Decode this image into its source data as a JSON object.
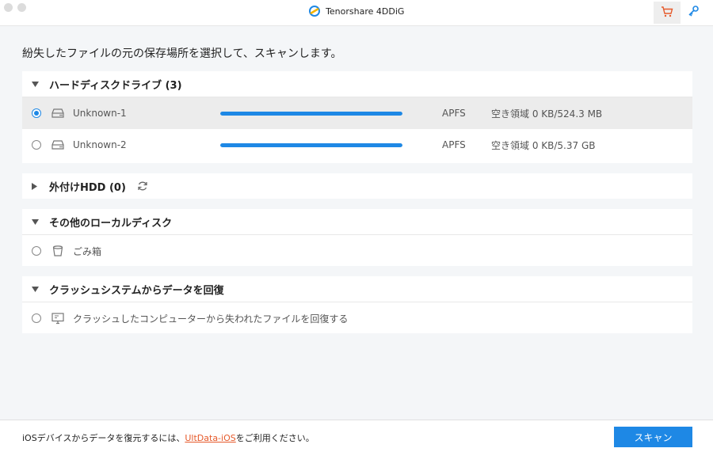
{
  "app": {
    "title": "Tenorshare 4DDiG"
  },
  "icons": {
    "cart": "shopping-cart-icon",
    "key": "key-icon",
    "accent": "#1e88e5",
    "cart_color": "#e65a2b"
  },
  "instruction": "紛失したファイルの元の保存場所を選択して、スキャンします。",
  "sections": {
    "hdd": {
      "title": "ハードディスクドライブ (3)",
      "expanded": true,
      "items": [
        {
          "name": "Unknown-1",
          "fs": "APFS",
          "free": "空き領域 0 KB/524.3 MB",
          "usage": 1.0,
          "selected": true
        },
        {
          "name": "Unknown-2",
          "fs": "APFS",
          "free": "空き領域 0 KB/5.37 GB",
          "usage": 1.0,
          "selected": false
        }
      ]
    },
    "external": {
      "title": "外付けHDD (0)",
      "expanded": false
    },
    "other": {
      "title": "その他のローカルディスク",
      "expanded": true,
      "items": [
        {
          "name": "ごみ箱"
        }
      ]
    },
    "crash": {
      "title": "クラッシュシステムからデータを回復",
      "expanded": true,
      "items": [
        {
          "name": "クラッシュしたコンピューターから失われたファイルを回復する"
        }
      ]
    }
  },
  "footer": {
    "text_before": "iOSデバイスからデータを復元するには、",
    "link": "UltData-iOS",
    "text_after": "をご利用ください。",
    "scan_label": "スキャン"
  }
}
